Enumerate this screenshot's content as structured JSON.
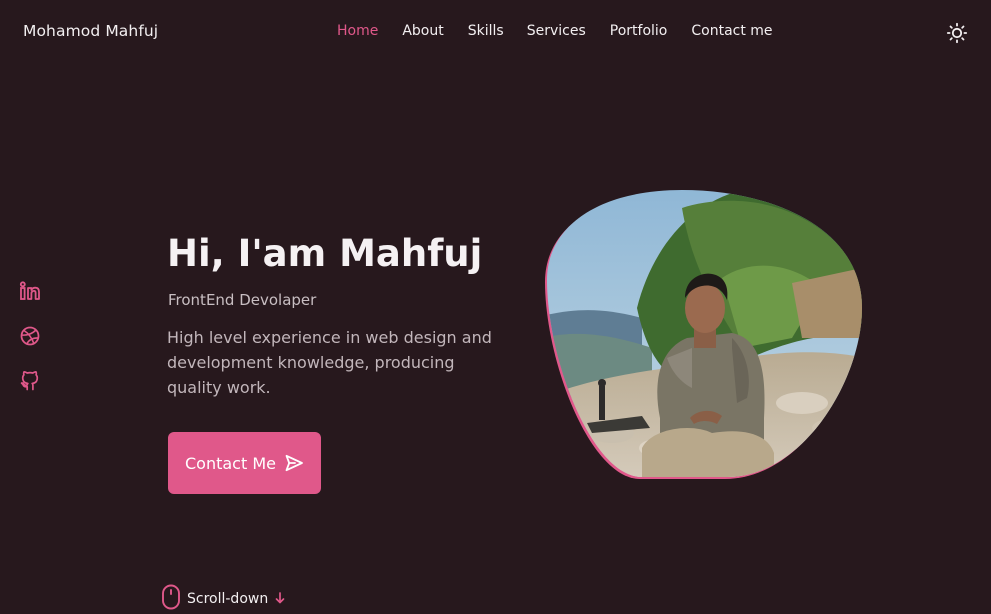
{
  "header": {
    "logo": "Mohamod Mahfuj",
    "nav": [
      {
        "label": "Home",
        "active": true
      },
      {
        "label": "About",
        "active": false
      },
      {
        "label": "Skills",
        "active": false
      },
      {
        "label": "Services",
        "active": false
      },
      {
        "label": "Portfolio",
        "active": false
      },
      {
        "label": "Contact me",
        "active": false
      }
    ],
    "theme_icon": "sun-icon"
  },
  "social": [
    {
      "icon": "linkedin-icon"
    },
    {
      "icon": "dribbble-icon"
    },
    {
      "icon": "github-icon"
    }
  ],
  "hero": {
    "title": "Hi, I'am Mahfuj",
    "subtitle": "FrontEnd Devolaper",
    "description": "High level experience in web design and development knowledge, producing quality work.",
    "cta_label": "Contact Me",
    "cta_icon": "send-icon",
    "image_icon": "profile-photo"
  },
  "scroll": {
    "label": "Scroll-down",
    "mouse_icon": "mouse-icon",
    "arrow_icon": "arrow-down-icon"
  },
  "colors": {
    "background": "#27181d",
    "accent": "#e0588a",
    "text": "#f3eff1",
    "muted_text": "#c2b6bb"
  }
}
